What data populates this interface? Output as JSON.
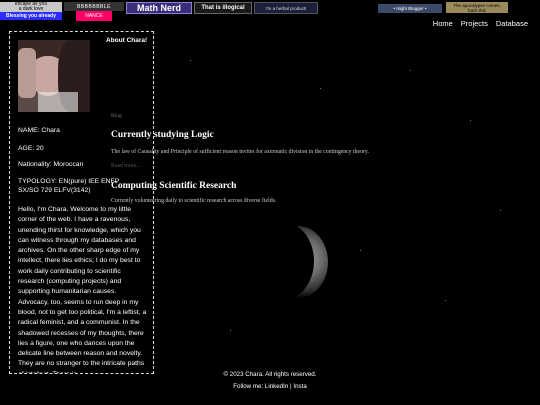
{
  "banners": {
    "b1_line1": "escape as you",
    "b1_line2": "a dark love",
    "b2": "BBBBBBBLE",
    "b3": "Math Nerd",
    "b4": "That is illogical",
    "b5": "I'm a herbal product!",
    "b6": "• Night Blogger •",
    "b7_line1": "The apocalypse comes,",
    "b7_line2": "back this",
    "b8": "Blessing you already",
    "b9": "NANCE"
  },
  "nav": {
    "home": "Home",
    "projects": "Projects",
    "database": "Database"
  },
  "profile": {
    "title": "About Chara!",
    "name": "NAME: Chara",
    "age": "AGE: 20",
    "nationality": "Nationality: Moroccan",
    "typology_1": "TYPOLOGY: EN(pure) IEE ENFP",
    "typology_2": "SX/SO 729 ELFV(3142)",
    "bio": "Hello, I'm Chara. Welcome to my little corner of the web. I have a ravenous, unending thirst for knowledge, which you can witness through my databases and archives. On the other sharp edge of my intellect, there lies ethics; I do my best to work daily contributing to scientific research (computing projects) and supporting humanitarian causes. Advocacy, too, seems to run deep in my blood, not to get too political, I'm a leftist, a radical feminist, and a communist. In the shadowed recesses of my thoughts, there lies a figure, one who dances upon the delicate line between reason and novelty. They are no stranger to the intricate paths of intellect. There is"
  },
  "blog": {
    "label": "Blog",
    "posts": [
      {
        "title": "Currently studying Logic",
        "body": "The law of Causality and Principle of sufficient reason invites for axiomatic division in the contingency theory."
      },
      {
        "title": "Computing Scientific Research",
        "body": "Currently volunteering daily to scientific research across diverse fields."
      }
    ],
    "read_more": "Read more..."
  },
  "footer": {
    "copyright": "© 2023 Chara. All rights reserved.",
    "follow": "Follow me:",
    "linkedin": "LinkedIn",
    "separator": "|",
    "insta": "Insta"
  }
}
